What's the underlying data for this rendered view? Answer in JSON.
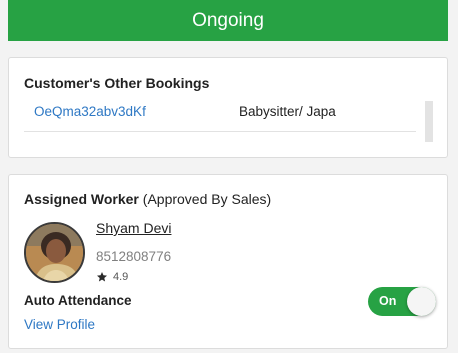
{
  "status": {
    "label": "Ongoing",
    "color": "#27a244"
  },
  "other_bookings": {
    "title": "Customer's Other Bookings",
    "items": [
      {
        "id": "OeQma32abv3dKf",
        "service": "Babysitter/ Japa"
      }
    ]
  },
  "assigned_worker": {
    "heading_bold": "Assigned Worker",
    "heading_note": "(Approved By Sales)",
    "name": "Shyam Devi",
    "phone": "8512808776",
    "rating": "4.9",
    "auto_attendance_label": "Auto Attendance",
    "auto_attendance_state": "On",
    "view_profile_label": "View Profile",
    "icons": {
      "rating": "star-icon"
    }
  },
  "colors": {
    "accent_green": "#27a244",
    "link_blue": "#2e78c4"
  }
}
